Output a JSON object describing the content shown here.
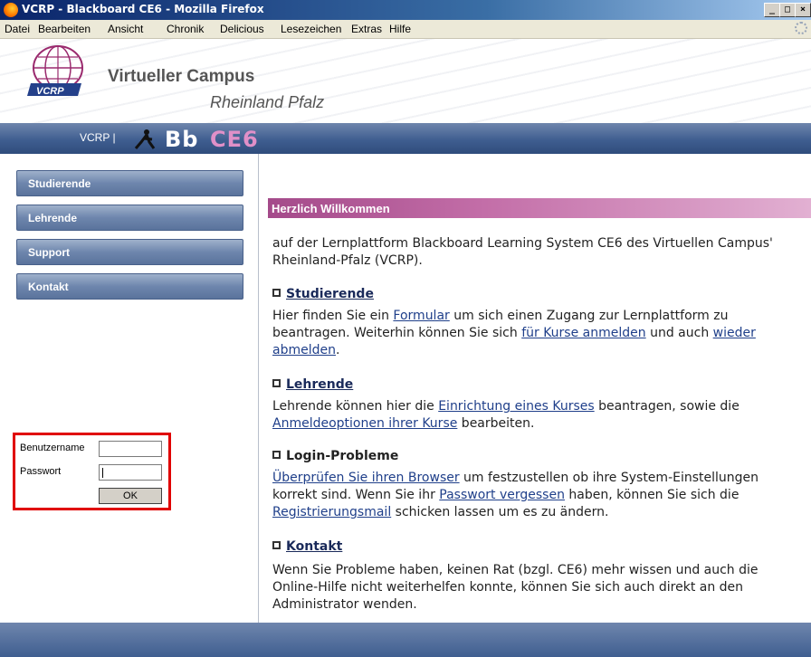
{
  "window": {
    "title": "VCRP - Blackboard CE6 - Mozilla Firefox",
    "controls": [
      "_",
      "□",
      "×"
    ]
  },
  "menu": [
    "Datei",
    "Bearbeiten",
    "Ansicht",
    "Chronik",
    "Delicious",
    "Lesezeichen",
    "Extras",
    "Hilfe"
  ],
  "header": {
    "logo_text": "VCRP",
    "title": "Virtueller Campus",
    "subtitle": "Rheinland Pfalz"
  },
  "banner": {
    "vcrp": "VCRP |",
    "bb": "Bb",
    "ce6": "CE6"
  },
  "sidebar": {
    "items": [
      {
        "label": "Studierende"
      },
      {
        "label": "Lehrende"
      },
      {
        "label": "Support"
      },
      {
        "label": "Kontakt"
      }
    ]
  },
  "login": {
    "username_label": "Benutzername",
    "password_label": "Passwort",
    "ok_label": "OK"
  },
  "main": {
    "welcome": "Herzlich Willkommen",
    "intro": "auf der Lernplattform Blackboard Learning System CE6 des Virtuellen Campus' Rheinland-Pfalz (VCRP).",
    "sections": {
      "studierende": {
        "heading": "Studierende",
        "t1": "Hier finden Sie ein ",
        "link1": "Formular",
        "t2": " um sich einen Zugang zur Lernplattform zu beantragen. Weiterhin können Sie sich ",
        "link2": "für Kurse anmelden",
        "t3": " und auch ",
        "link3": "wieder abmelden",
        "t4": "."
      },
      "lehrende": {
        "heading": "Lehrende",
        "t1": "Lehrende können hier die ",
        "link1": "Einrichtung eines Kurses",
        "t2": " beantragen, sowie die ",
        "link2": "Anmeldeoptionen ihrer Kurse",
        "t3": " bearbeiten."
      },
      "login": {
        "heading": "Login-Probleme",
        "link1": "Überprüfen Sie ihren Browser",
        "t1": " um festzustellen ob ihre System-Einstellungen korrekt sind. Wenn Sie ihr ",
        "link2": "Passwort vergessen",
        "t2": " haben, können Sie sich die ",
        "link3": "Registrierungsmail",
        "t3": " schicken lassen um es zu ändern."
      },
      "kontakt": {
        "heading": "Kontakt",
        "text": "Wenn Sie Probleme haben, keinen Rat (bzgl. CE6) mehr wissen und auch die Online-Hilfe nicht weiterhelfen konnte, können Sie sich auch direkt an den Administrator wenden."
      }
    }
  }
}
